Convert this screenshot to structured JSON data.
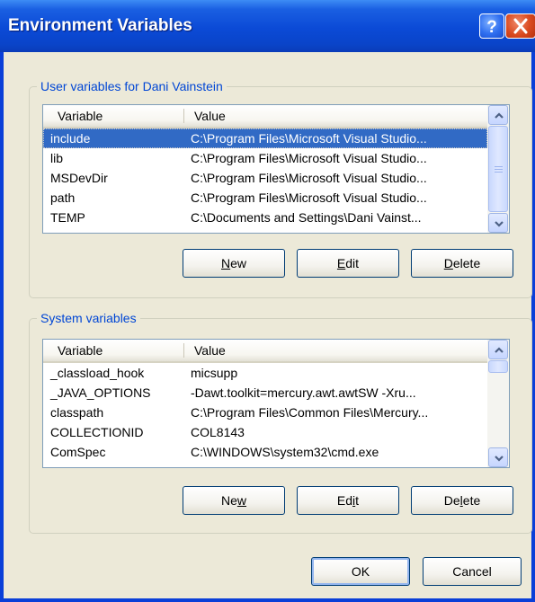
{
  "window": {
    "title": "Environment Variables"
  },
  "user_vars": {
    "group_label": "User variables for Dani Vainstein",
    "columns": [
      "Variable",
      "Value"
    ],
    "rows": [
      {
        "name": "include",
        "value": "C:\\Program Files\\Microsoft Visual Studio..."
      },
      {
        "name": "lib",
        "value": "C:\\Program Files\\Microsoft Visual Studio..."
      },
      {
        "name": "MSDevDir",
        "value": "C:\\Program Files\\Microsoft Visual Studio..."
      },
      {
        "name": "path",
        "value": "C:\\Program Files\\Microsoft Visual Studio..."
      },
      {
        "name": "TEMP",
        "value": "C:\\Documents and Settings\\Dani Vainst..."
      }
    ],
    "selected_row": "include",
    "buttons": {
      "new": {
        "pre": "",
        "key": "N",
        "post": "ew"
      },
      "edit": {
        "pre": "",
        "key": "E",
        "post": "dit"
      },
      "delete": {
        "pre": "",
        "key": "D",
        "post": "elete"
      }
    }
  },
  "system_vars": {
    "group_label": "System variables",
    "columns": [
      "Variable",
      "Value"
    ],
    "rows": [
      {
        "name": "_classload_hook",
        "value": "micsupp"
      },
      {
        "name": "_JAVA_OPTIONS",
        "value": "-Dawt.toolkit=mercury.awt.awtSW -Xru..."
      },
      {
        "name": "classpath",
        "value": "C:\\Program Files\\Common Files\\Mercury..."
      },
      {
        "name": "COLLECTIONID",
        "value": "COL8143"
      },
      {
        "name": "ComSpec",
        "value": "C:\\WINDOWS\\system32\\cmd.exe"
      }
    ],
    "buttons": {
      "new": {
        "pre": "Ne",
        "key": "w",
        "post": ""
      },
      "edit": {
        "pre": "Ed",
        "key": "i",
        "post": "t"
      },
      "delete": {
        "pre": "De",
        "key": "l",
        "post": "ete"
      }
    }
  },
  "footer": {
    "ok_label": "OK",
    "cancel_label": "Cancel"
  },
  "icons": {
    "help": "help-icon",
    "close": "close-icon",
    "scroll_up": "chevron-up-icon",
    "scroll_down": "chevron-down-icon"
  },
  "colors": {
    "title_bar": "#0b4ad6",
    "selection": "#316ac5",
    "group_label": "#0046d5",
    "dialog_face": "#ece9d8"
  }
}
